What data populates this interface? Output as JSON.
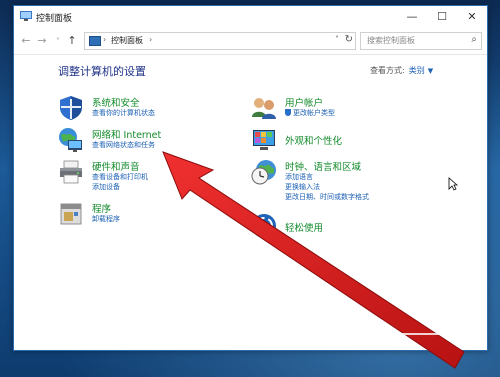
{
  "window": {
    "title": "控制面板",
    "controls": {
      "minimize": "—",
      "maximize": "☐",
      "close": "✕"
    }
  },
  "nav": {
    "address": "控制面板",
    "search_placeholder": "搜索控制面板"
  },
  "main": {
    "heading": "调整计算机的设置",
    "view_by_label": "查看方式:",
    "view_by_value": "类别"
  },
  "categories_left": [
    {
      "icon": "shield-icon",
      "title": "系统和安全",
      "links": [
        "查看你的计算机状态"
      ]
    },
    {
      "icon": "globe-network-icon",
      "title": "网络和 Internet",
      "links": [
        "查看网络状态和任务"
      ]
    },
    {
      "icon": "printer-icon",
      "title": "硬件和声音",
      "links": [
        "查看设备和打印机",
        "添加设备"
      ]
    },
    {
      "icon": "programs-icon",
      "title": "程序",
      "links": [
        "卸载程序"
      ]
    }
  ],
  "categories_right": [
    {
      "icon": "users-icon",
      "title": "用户帐户",
      "links": [
        "更改帐户类型"
      ]
    },
    {
      "icon": "appearance-icon",
      "title": "外观和个性化",
      "links": []
    },
    {
      "icon": "clock-globe-icon",
      "title": "时钟、语言和区域",
      "links": [
        "添加语言",
        "更换输入法",
        "更改日期、时间或数字格式"
      ]
    },
    {
      "icon": "ease-of-access-icon",
      "title": "轻松使用",
      "links": []
    }
  ],
  "colors": {
    "category_title": "#138a2c",
    "link": "#1a5fb4",
    "heading": "#1e3287",
    "annotation_arrow": "#e01e1e"
  }
}
